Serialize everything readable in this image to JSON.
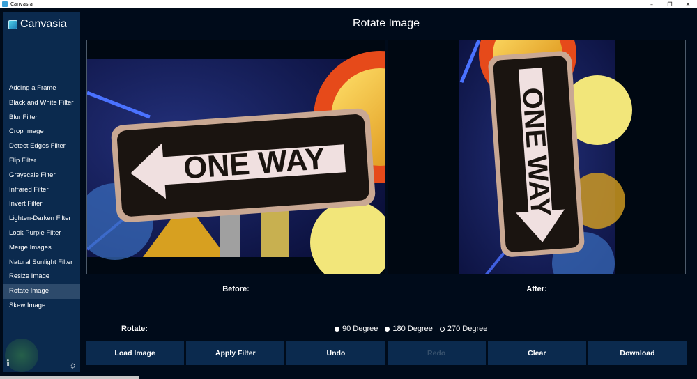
{
  "window": {
    "title": "Canvasia",
    "minimize": "–",
    "maximize": "❐",
    "close": "✕"
  },
  "sidebar": {
    "brand": "Canvasia",
    "items": [
      {
        "label": "Adding a Frame"
      },
      {
        "label": "Black and White Filter"
      },
      {
        "label": "Blur Filter"
      },
      {
        "label": "Crop Image"
      },
      {
        "label": "Detect Edges Filter"
      },
      {
        "label": "Flip Filter"
      },
      {
        "label": "Grayscale Filter"
      },
      {
        "label": "Infrared Filter"
      },
      {
        "label": "Invert Filter"
      },
      {
        "label": "Lighten-Darken Filter"
      },
      {
        "label": "Look Purple Filter"
      },
      {
        "label": "Merge Images"
      },
      {
        "label": "Natural Sunlight Filter"
      },
      {
        "label": "Resize Image"
      },
      {
        "label": "Rotate Image",
        "active": true
      },
      {
        "label": "Skew Image"
      }
    ],
    "info_icon": "i",
    "settings_icon": "☼"
  },
  "main": {
    "title": "Rotate Image",
    "before_label": "Before:",
    "after_label": "After:",
    "sign_text": "ONE WAY",
    "rotate_label": "Rotate:",
    "options": [
      {
        "label": "90 Degree",
        "selected": false
      },
      {
        "label": "180 Degree",
        "selected": false
      },
      {
        "label": "270 Degree",
        "selected": true
      }
    ]
  },
  "toolbar": {
    "buttons": [
      {
        "label": "Load Image",
        "enabled": true
      },
      {
        "label": "Apply Filter",
        "enabled": true
      },
      {
        "label": "Undo",
        "enabled": true
      },
      {
        "label": "Redo",
        "enabled": false
      },
      {
        "label": "Clear",
        "enabled": true
      },
      {
        "label": "Download",
        "enabled": true
      }
    ]
  },
  "colors": {
    "background": "#000b1a",
    "sidebar": "#0b2a4e",
    "active_item": "#2d4a6b",
    "sign_black": "#1a1410",
    "sign_white": "#f0e0e0"
  }
}
